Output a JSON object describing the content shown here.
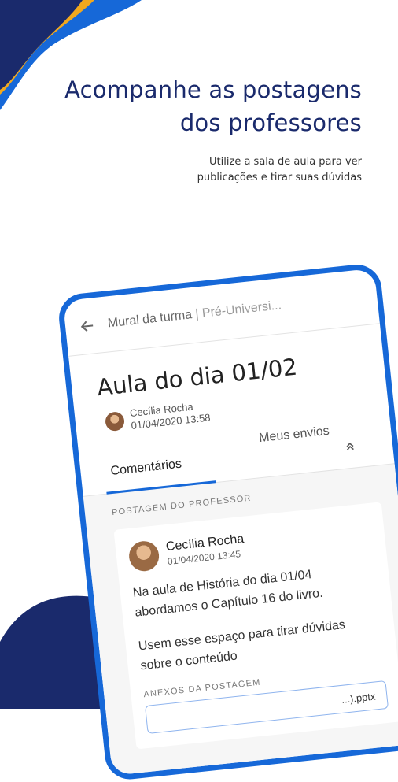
{
  "hero": {
    "title_line1": "Acompanhe as postagens",
    "title_line2": "dos professores",
    "subtitle_line1": "Utilize a sala de aula para ver",
    "subtitle_line2": "publicações e tirar suas dúvidas"
  },
  "phone": {
    "topbar": {
      "back_icon": "arrow-left-icon",
      "title": "Mural da turma",
      "separator": " | ",
      "subtitle": "Pré-Universi..."
    },
    "post": {
      "title": "Aula do dia 01/02",
      "author_name": "Cecília Rocha",
      "author_date": "01/04/2020 13:58"
    },
    "tabs": {
      "active": "Comentários",
      "inactive": "Meus envios",
      "collapse_icon": "chevrons-up-icon"
    },
    "teacher_post": {
      "section_label": "POSTAGEM DO PROFESSOR",
      "author_name": "Cecília Rocha",
      "author_date": "01/04/2020 13:45",
      "paragraph1": "Na aula de História do dia 01/04 abordamos o Capítulo 16 do livro.",
      "paragraph2": "Usem esse espaço para tirar dúvidas sobre o conteúdo",
      "attachments_label": "ANEXOS DA POSTAGEM",
      "attachment_name": "...).pptx"
    }
  },
  "colors": {
    "navy": "#1a2a6c",
    "brand_blue": "#1668d8",
    "accent_orange": "#f2a81d"
  }
}
